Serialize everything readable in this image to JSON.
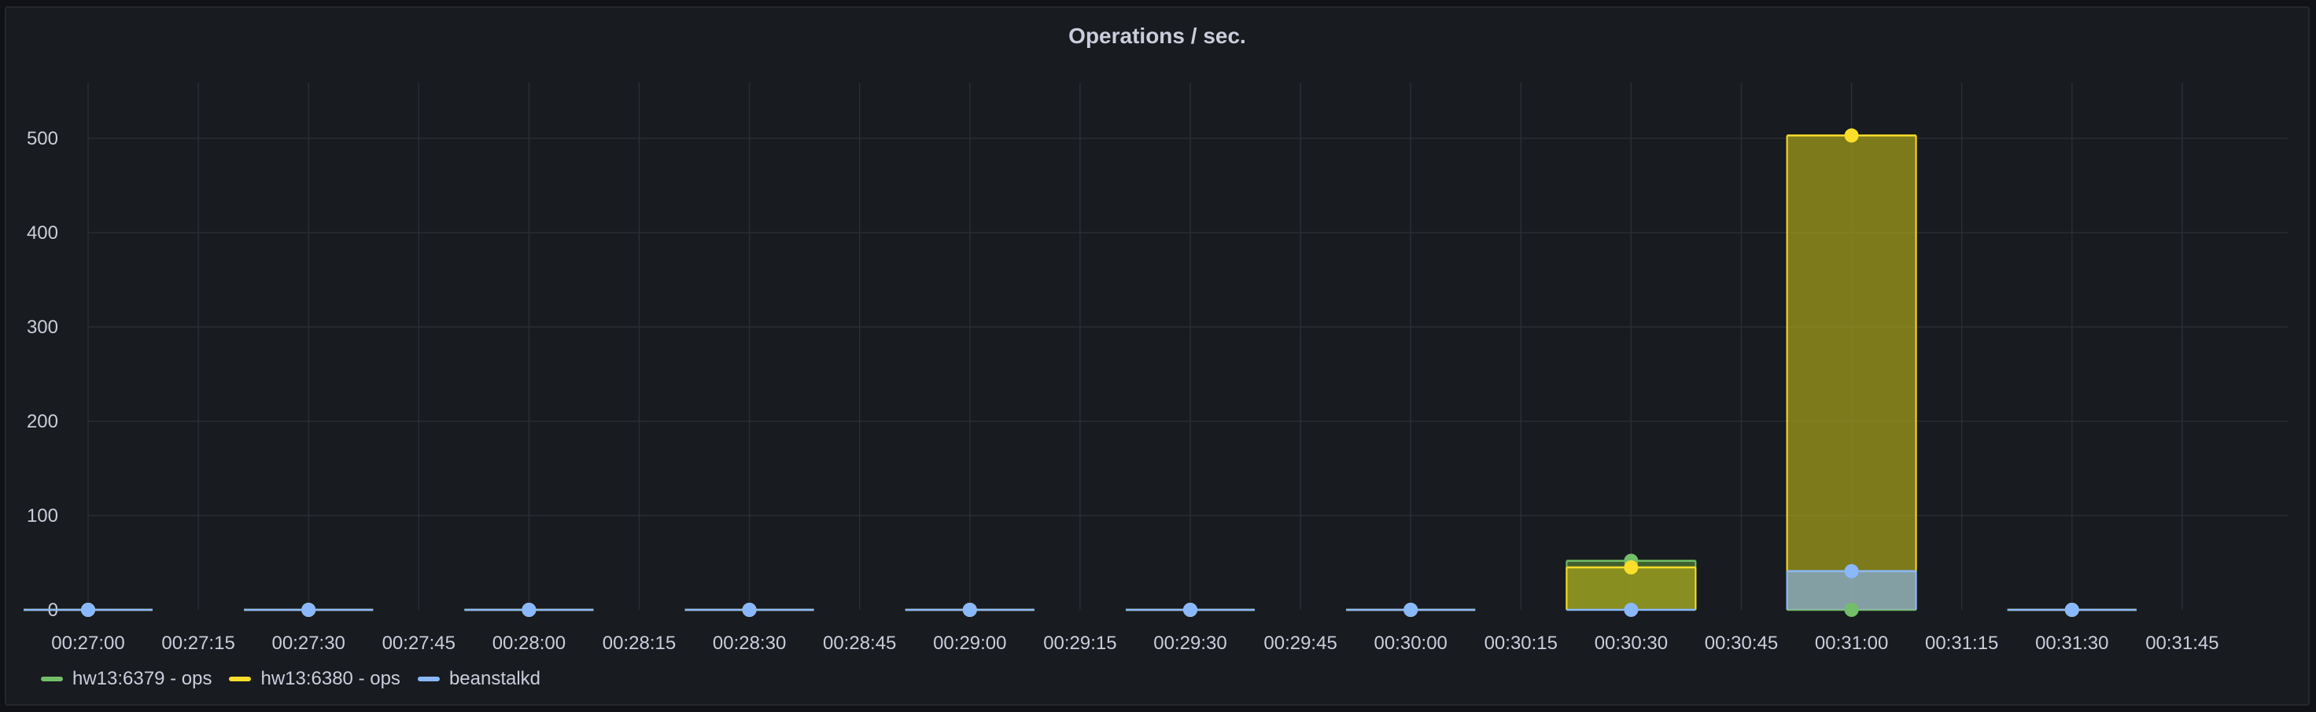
{
  "panel": {
    "title": "Operations / sec."
  },
  "chart_data": {
    "type": "bar",
    "title": "Operations / sec.",
    "xlabel": "",
    "ylabel": "",
    "ylim": [
      0,
      560
    ],
    "yticks": [
      0,
      100,
      200,
      300,
      400,
      500
    ],
    "grid": true,
    "legend_position": "bottom-left",
    "x_ticks": [
      "00:27:00",
      "00:27:15",
      "00:27:30",
      "00:27:45",
      "00:28:00",
      "00:28:15",
      "00:28:30",
      "00:28:45",
      "00:29:00",
      "00:29:15",
      "00:29:30",
      "00:29:45",
      "00:30:00",
      "00:30:15",
      "00:30:30",
      "00:30:45",
      "00:31:00",
      "00:31:15",
      "00:31:30",
      "00:31:45"
    ],
    "categories": [
      "00:27:00",
      "00:27:30",
      "00:28:00",
      "00:28:30",
      "00:29:00",
      "00:29:30",
      "00:30:00",
      "00:30:30",
      "00:31:00",
      "00:31:30"
    ],
    "series": [
      {
        "name": "hw13:6379 - ops",
        "color": "#73bf69",
        "values": [
          0,
          0,
          0,
          0,
          0,
          0,
          0,
          52,
          0,
          0
        ]
      },
      {
        "name": "hw13:6380 - ops",
        "color": "#fade2a",
        "values": [
          0,
          0,
          0,
          0,
          0,
          0,
          0,
          45,
          503,
          0
        ]
      },
      {
        "name": "beanstalkd",
        "color": "#8ab8ff",
        "values": [
          0,
          0,
          0,
          0,
          0,
          0,
          0,
          0,
          41,
          0
        ]
      }
    ]
  }
}
